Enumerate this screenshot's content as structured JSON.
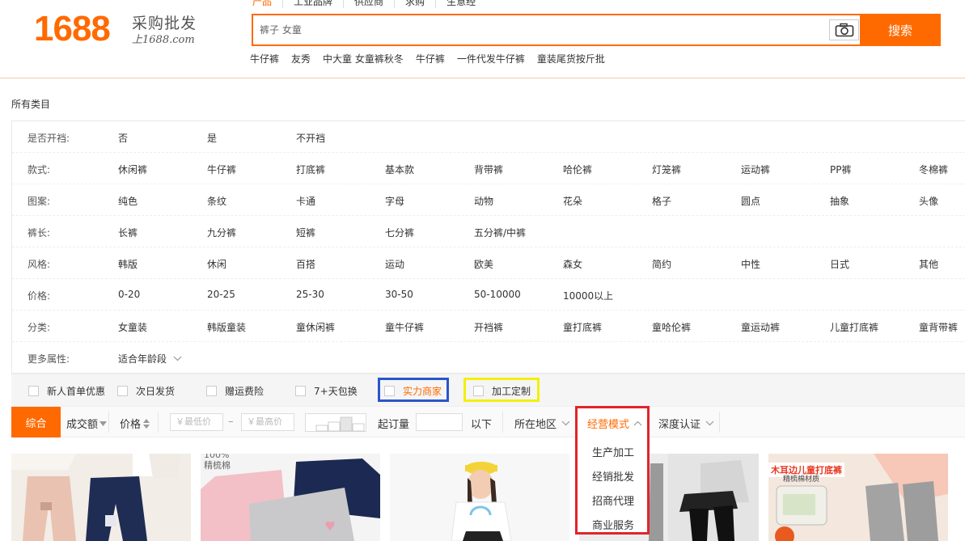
{
  "header": {
    "logo_number": "1688",
    "logo_slogan": "采购批发",
    "logo_url": "上1688.com",
    "search_tabs": [
      "产品",
      "工业品牌",
      "供应商",
      "求购",
      "生意经"
    ],
    "search_placeholder": "裤子 女童",
    "search_button": "搜索",
    "hot_words": [
      "牛仔裤",
      "友秀",
      "中大童 女童裤秋冬",
      "牛仔裤",
      "一件代发牛仔裤",
      "童装尾货按斤批"
    ]
  },
  "breadcrumb": "所有类目",
  "filters": [
    {
      "label": "是否开裆:",
      "options": [
        "否",
        "是",
        "不开裆"
      ]
    },
    {
      "label": "款式:",
      "options": [
        "休闲裤",
        "牛仔裤",
        "打底裤",
        "基本款",
        "背带裤",
        "哈伦裤",
        "灯笼裤",
        "运动裤",
        "PP裤",
        "冬棉裤"
      ]
    },
    {
      "label": "图案:",
      "options": [
        "纯色",
        "条纹",
        "卡通",
        "字母",
        "动物",
        "花朵",
        "格子",
        "圆点",
        "抽象",
        "头像"
      ]
    },
    {
      "label": "裤长:",
      "options": [
        "长裤",
        "九分裤",
        "短裤",
        "七分裤",
        "五分裤/中裤"
      ]
    },
    {
      "label": "风格:",
      "options": [
        "韩版",
        "休闲",
        "百搭",
        "运动",
        "欧美",
        "森女",
        "简约",
        "中性",
        "日式",
        "其他"
      ]
    },
    {
      "label": "价格:",
      "options": [
        "0-20",
        "20-25",
        "25-30",
        "30-50",
        "50-10000",
        "10000以上"
      ]
    },
    {
      "label": "分类:",
      "options": [
        "女童装",
        "韩版童装",
        "童休闲裤",
        "童牛仔裤",
        "开裆裤",
        "童打底裤",
        "童哈伦裤",
        "童运动裤",
        "儿童打底裤",
        "童背带裤"
      ]
    },
    {
      "label": "更多属性:",
      "options": [
        "适合年龄段"
      ]
    }
  ],
  "services": [
    "新人首单优惠",
    "次日发货",
    "赠运费险",
    "7+天包换",
    "实力商家",
    "加工定制"
  ],
  "sort_bar": {
    "active": "综合",
    "volume": "成交额",
    "price": "价格",
    "min_price_placeholder": "￥最低价",
    "dash": "–",
    "max_price_placeholder": "￥最高价",
    "moq_label": "起订量",
    "moq_suffix": "以下",
    "region": "所在地区",
    "business_mode": "经营模式",
    "certification": "深度认证"
  },
  "business_mode_options": [
    "生产加工",
    "经销批发",
    "招商代理",
    "商业服务"
  ],
  "product_labels": {
    "p2_text1": "100%",
    "p2_text2": "精梳棉",
    "p6_banner": "木耳边儿童打底裤",
    "p6_sub": "精梳棉材质"
  },
  "colors": {
    "brand_orange": "#ff6a00",
    "highlight_blue": "#2b55c8",
    "highlight_yellow": "#f3ef0a",
    "highlight_red": "#e0252b"
  }
}
